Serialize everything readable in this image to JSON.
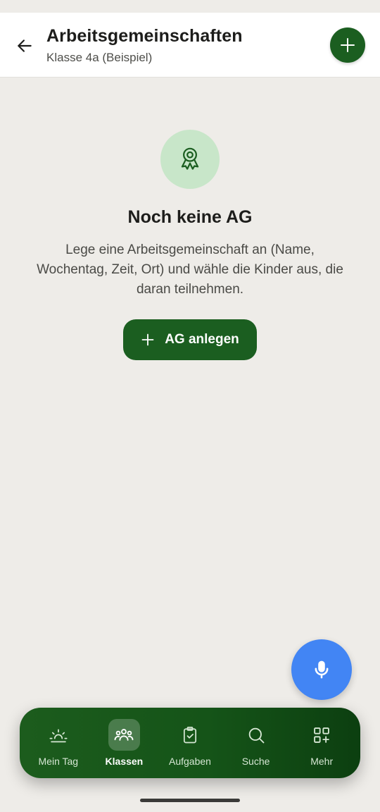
{
  "header": {
    "back_icon": "arrow-left-icon",
    "title": "Arbeitsgemeinschaften",
    "subtitle": "Klasse 4a (Beispiel)",
    "add_icon": "plus-icon"
  },
  "empty_state": {
    "icon": "award-icon",
    "title": "Noch keine AG",
    "description": "Lege eine Arbeitsgemeinschaft an (Name, Wochentag, Zeit, Ort) und wähle die Kinder aus, die daran teilnehmen.",
    "button_label": "AG anlegen",
    "button_icon": "plus-icon"
  },
  "voice": {
    "icon": "microphone-icon"
  },
  "bottom_nav": {
    "items": [
      {
        "label": "Mein Tag",
        "icon": "sunrise-icon",
        "active": false
      },
      {
        "label": "Klassen",
        "icon": "users-icon",
        "active": true
      },
      {
        "label": "Aufgaben",
        "icon": "clipboard-check-icon",
        "active": false
      },
      {
        "label": "Suche",
        "icon": "search-icon",
        "active": false
      },
      {
        "label": "Mehr",
        "icon": "grid-plus-icon",
        "active": false
      }
    ]
  },
  "colors": {
    "primary": "#1b5e20",
    "primary_light": "#c8e6c9",
    "voice_button": "#4285f4",
    "background": "#eeece8",
    "header_background": "#ffffff"
  }
}
